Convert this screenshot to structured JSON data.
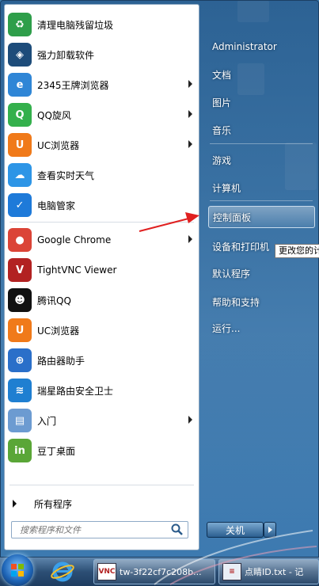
{
  "left_menu": {
    "pinned": [
      {
        "label": "清理电脑残留垃圾",
        "icon": "recycle-icon",
        "color": "#2e9e4a",
        "has_arrow": false
      },
      {
        "label": "强力卸载软件",
        "icon": "uninstall-shield-icon",
        "color": "#1d4c7a",
        "has_arrow": false
      },
      {
        "label": "2345王牌浏览器",
        "icon": "browser-e-icon",
        "color": "#2f86d6",
        "has_arrow": true
      },
      {
        "label": "QQ旋风",
        "icon": "qq-whirlwind-icon",
        "color": "#34b04c",
        "has_arrow": true
      },
      {
        "label": "UC浏览器",
        "icon": "uc-browser-icon",
        "color": "#f07a1a",
        "has_arrow": true
      },
      {
        "label": "查看实时天气",
        "icon": "weather-cloud-icon",
        "color": "#2d95e6",
        "has_arrow": false
      },
      {
        "label": "电脑管家",
        "icon": "pc-manager-shield-icon",
        "color": "#1e7ad9",
        "has_arrow": false
      }
    ],
    "recent": [
      {
        "label": "Google Chrome",
        "icon": "chrome-icon",
        "color": "#db4437",
        "has_arrow": true
      },
      {
        "label": "TightVNC Viewer",
        "icon": "vnc-icon",
        "color": "#b22222",
        "has_arrow": false
      },
      {
        "label": "腾讯QQ",
        "icon": "qq-penguin-icon",
        "color": "#111111",
        "has_arrow": false
      },
      {
        "label": "UC浏览器",
        "icon": "uc-browser-icon",
        "color": "#f07a1a",
        "has_arrow": false
      },
      {
        "label": "路由器助手",
        "icon": "router-assistant-icon",
        "color": "#2a6fc9",
        "has_arrow": false
      },
      {
        "label": "瑞星路由安全卫士",
        "icon": "router-wifi-icon",
        "color": "#1f7fd1",
        "has_arrow": false
      },
      {
        "label": "入门",
        "icon": "getting-started-icon",
        "color": "#6c9bd1",
        "has_arrow": true
      },
      {
        "label": "豆丁桌面",
        "icon": "docin-desktop-icon",
        "color": "#5aa637",
        "has_arrow": false
      }
    ],
    "all_programs": "所有程序",
    "search_placeholder": "搜索程序和文件"
  },
  "right_menu": {
    "items": [
      {
        "label": "Administrator"
      },
      {
        "label": "文档"
      },
      {
        "label": "图片"
      },
      {
        "label": "音乐"
      },
      {
        "label": "游戏"
      },
      {
        "label": "计算机"
      },
      {
        "label": "控制面板"
      },
      {
        "label": "设备和打印机"
      },
      {
        "label": "默认程序"
      },
      {
        "label": "帮助和支持"
      },
      {
        "label": "运行..."
      }
    ],
    "tooltip": "更改您的计",
    "shutdown_label": "关机"
  },
  "taskbar": {
    "tasks": [
      {
        "label": "tw-3f22cf7c208b...",
        "icon": "vnc-icon"
      },
      {
        "label": "点睛ID.txt - 记",
        "icon": "notepad-icon"
      }
    ]
  },
  "colors": {
    "highlight_border": "#c9dcec",
    "arrow_red": "#e02020"
  }
}
